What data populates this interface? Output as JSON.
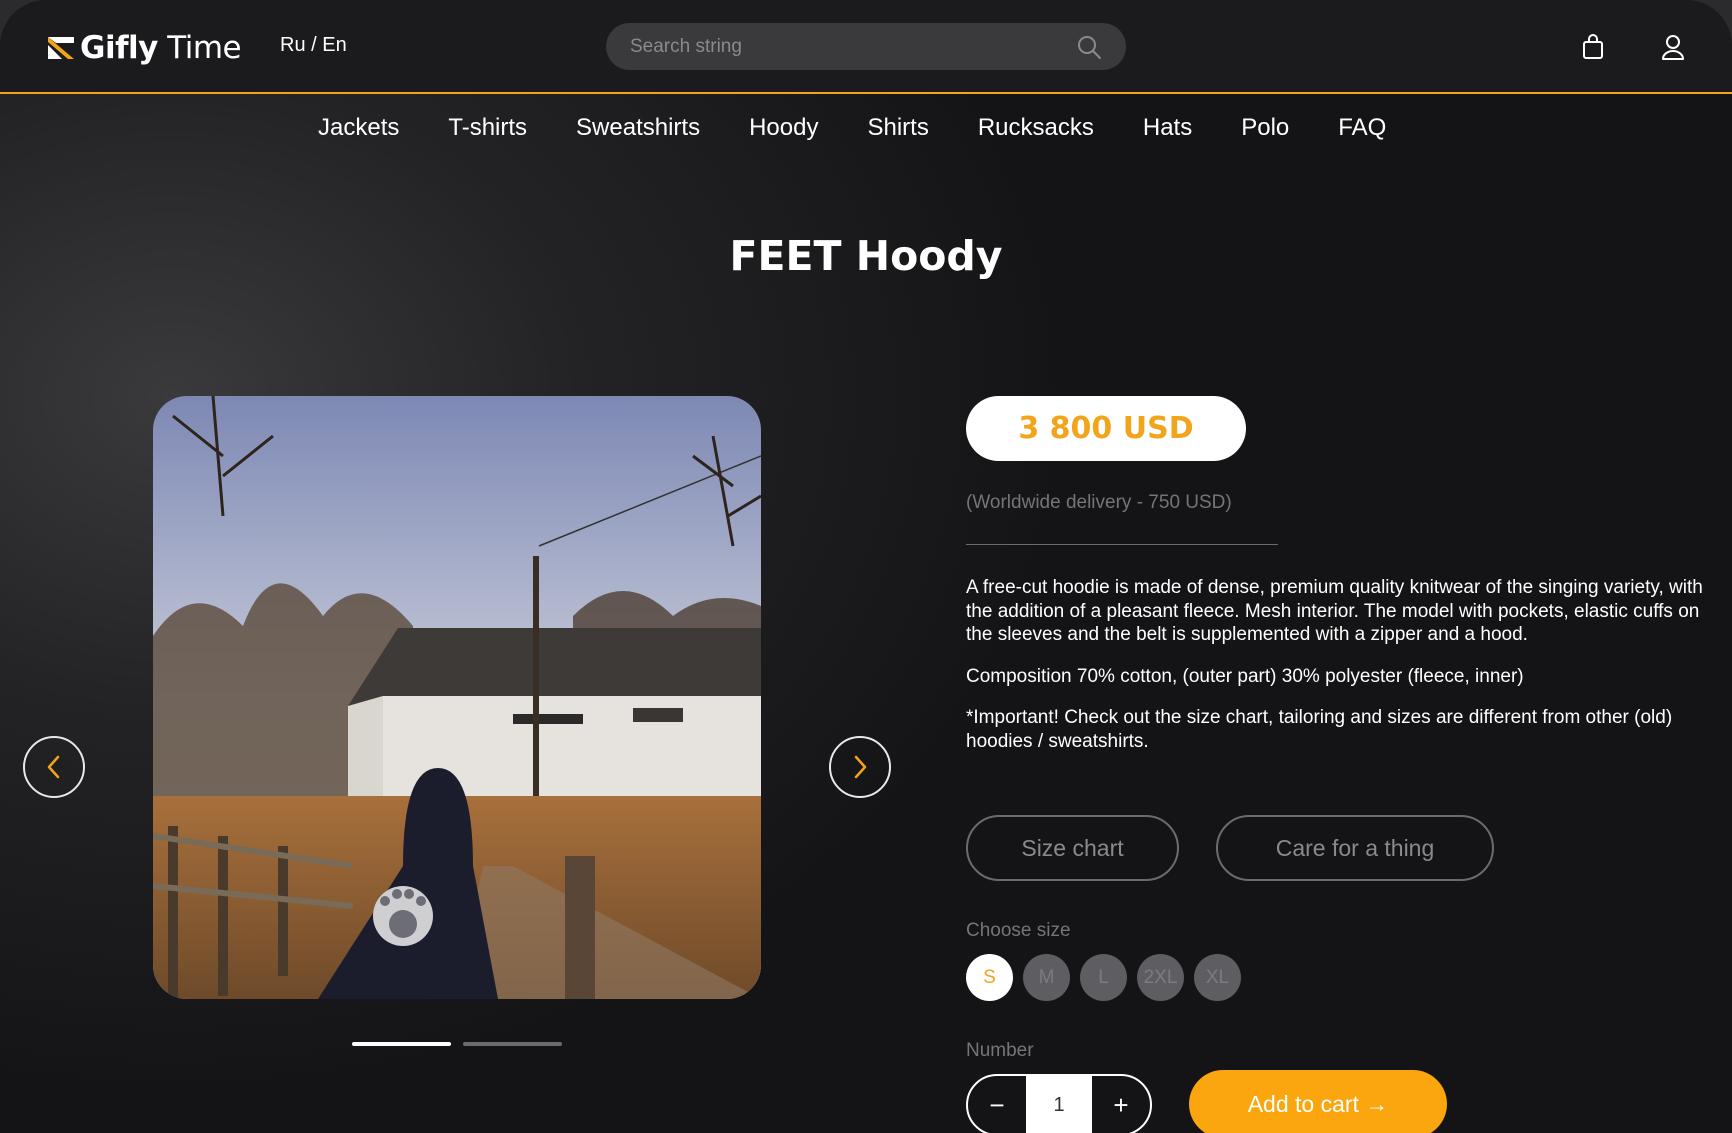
{
  "header": {
    "logo_bold": "Gifly",
    "logo_regular": "Time",
    "lang": "Ru / En",
    "search_placeholder": "Search string"
  },
  "nav": [
    "Jackets",
    "T-shirts",
    "Sweatshirts",
    "Hoody",
    "Shirts",
    "Rucksacks",
    "Hats",
    "Polo",
    "FAQ"
  ],
  "product": {
    "title": "FEET Hoody",
    "price": "3 800 USD",
    "delivery": "(Worldwide delivery - 750 USD)",
    "description": [
      "A free-cut hoodie is made of dense, premium quality knitwear of the singing variety, with the addition of a pleasant fleece. Mesh interior. The model with pockets, elastic cuffs on the sleeves and the belt is supplemented with a zipper and a hood.",
      "Composition 70% cotton, (outer part) 30% polyester (fleece, inner)",
      "*Important! Check out the size chart, tailoring and sizes are different from other (old) hoodies / sweatshirts."
    ],
    "size_chart_label": "Size chart",
    "care_label": "Care for a thing",
    "choose_size_label": "Choose size",
    "sizes": [
      "S",
      "M",
      "L",
      "2XL",
      "XL"
    ],
    "selected_size": "S",
    "number_label": "Number",
    "quantity": "1",
    "minus": "−",
    "plus": "+",
    "add_to_cart": "Add to cart →"
  },
  "gallery": {
    "slide_count": 2,
    "active_slide": 1
  },
  "colors": {
    "accent": "#f2a51a",
    "button": "#fba60f"
  }
}
